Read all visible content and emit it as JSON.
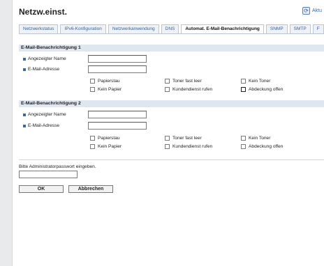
{
  "page": {
    "title": "Netzw.einst.",
    "refresh_label": "Aktu"
  },
  "tabs": [
    {
      "label": "Netzwerkstatus"
    },
    {
      "label": "IPv6-Konfiguration"
    },
    {
      "label": "Netzwerkanwendung"
    },
    {
      "label": "DNS"
    },
    {
      "label": "Automat. E-Mail-Benachrichtigung"
    },
    {
      "label": "SNMP"
    },
    {
      "label": "SMTP"
    },
    {
      "label": "F"
    }
  ],
  "notif1": {
    "heading": "E-Mail-Benachrichtigung 1",
    "display_name_label": "Angezeigter Name",
    "email_label": "E-Mail-Adresse",
    "display_name_value": "",
    "email_value": "",
    "options": [
      "Papierstau",
      "Toner fast leer",
      "Kein Toner",
      "Kein Papier",
      "Kundendienst rufen",
      "Abdeckung offen"
    ]
  },
  "notif2": {
    "heading": "E-Mail-Benachrichtigung 2",
    "display_name_label": "Angezeigter Name",
    "email_label": "E-Mail-Adresse",
    "display_name_value": "",
    "email_value": "",
    "options": [
      "Papierstau",
      "Toner fast leer",
      "Kein Toner",
      "Kein Papier",
      "Kundendienst rufen",
      "Abdeckung offen"
    ]
  },
  "admin": {
    "label": "Bitte Administratorpasswort eingeben.",
    "value": ""
  },
  "buttons": {
    "ok": "OK",
    "cancel": "Abbrechen"
  }
}
